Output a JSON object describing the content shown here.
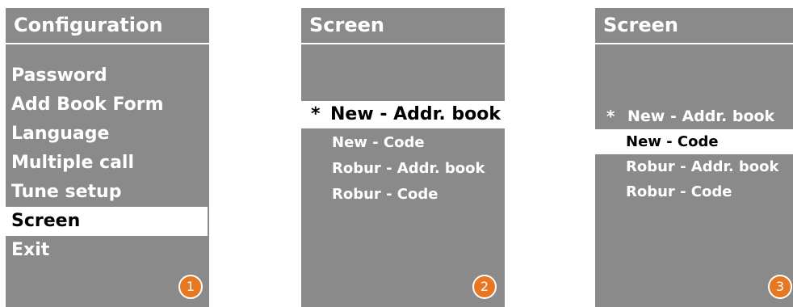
{
  "panels": [
    {
      "title": "Configuration",
      "items": [
        "Password",
        "Add Book Form",
        "Language",
        "Multiple call",
        "Tune setup",
        "Screen",
        "Exit"
      ],
      "selected_index": 5,
      "step": "1"
    },
    {
      "title": "Screen",
      "items": [
        "New - Addr. book",
        "New - Code",
        "Robur - Addr. book",
        "Robur - Code"
      ],
      "selected_index": 0,
      "marker": "*",
      "step": "2"
    },
    {
      "title": "Screen",
      "items": [
        "New - Addr. book",
        "New - Code",
        "Robur - Addr. book",
        "Robur - Code"
      ],
      "selected_index": 1,
      "marker": "*",
      "step": "3"
    }
  ],
  "colors": {
    "panel_background": "#8a8a8a",
    "highlight_background": "#ffffff",
    "highlight_text": "#000000",
    "step_badge": "#e87722"
  }
}
